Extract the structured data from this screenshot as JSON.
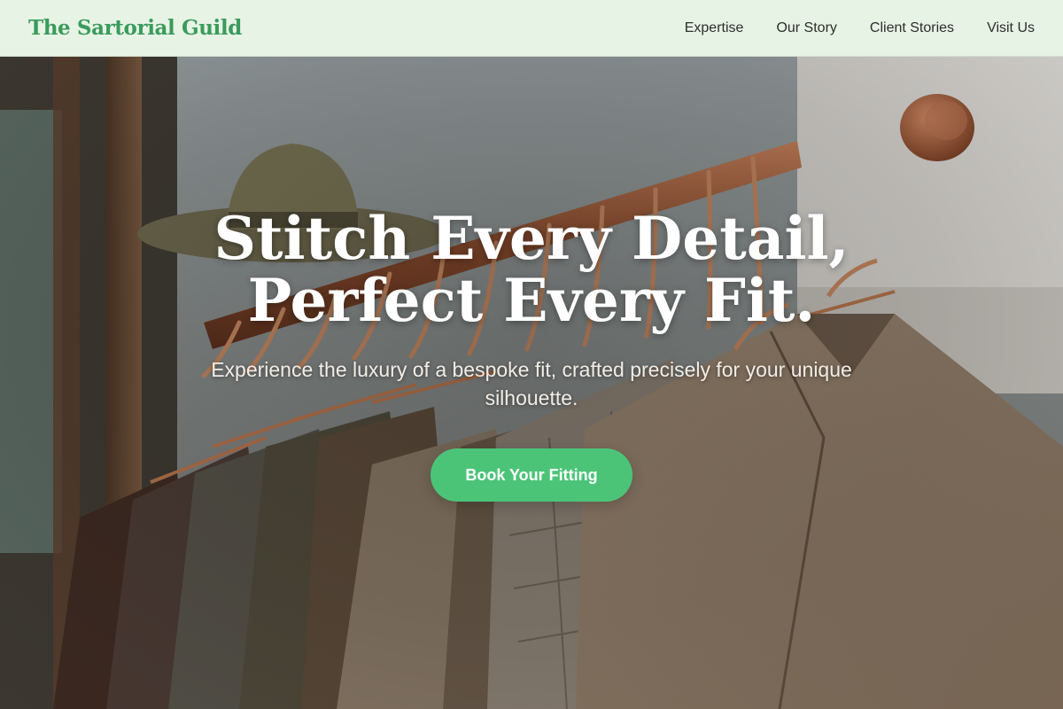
{
  "header": {
    "brand": "The Sartorial Guild",
    "nav": [
      "Expertise",
      "Our Story",
      "Client Stories",
      "Visit Us"
    ]
  },
  "hero": {
    "title_line1": "Stitch Every Detail,",
    "title_line2": "Perfect Every Fit.",
    "subtitle": "Experience the luxury of a bespoke fit, crafted precisely for your unique silhouette.",
    "cta": "Book Your Fitting",
    "background_image": "clothing-rack-with-jackets-and-hat"
  },
  "colors": {
    "brand": "#3a9b5c",
    "header_bg": "#e7f3e4",
    "cta": "#4cc478",
    "hero_text": "#ffffff"
  }
}
